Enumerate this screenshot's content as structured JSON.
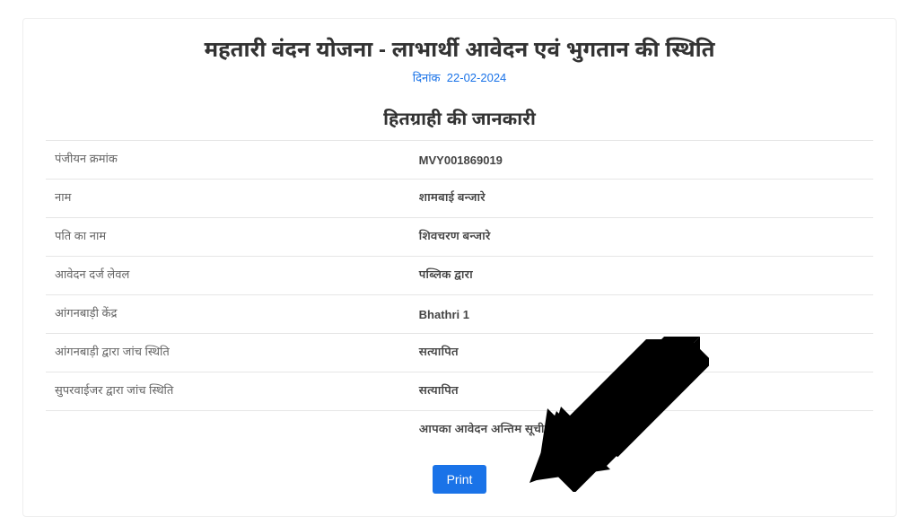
{
  "header": {
    "title": "महतारी वंदन योजना - लाभार्थी आवेदन एवं भुगतान की स्थिति",
    "date_prefix": "दिनांक",
    "date_value": "22-02-2024"
  },
  "section": {
    "heading": "हितग्राही की जानकारी"
  },
  "rows": {
    "r0": {
      "label": "पंजीयन क्रमांक",
      "value": "MVY001869019"
    },
    "r1": {
      "label": "नाम",
      "value": "शामबाई बन्जारे"
    },
    "r2": {
      "label": "पति का नाम",
      "value": "शिवचरण बन्जारे"
    },
    "r3": {
      "label": "आवेदन दर्ज लेवल",
      "value": "पब्लिक द्वारा"
    },
    "r4": {
      "label": "आंगनबाड़ी केंद्र",
      "value": "Bhathri 1"
    },
    "r5": {
      "label": "आंगनबाड़ी द्वारा जांच स्थिति",
      "value": "सत्यापित"
    },
    "r6": {
      "label": "सुपरवाईजर द्वारा जांच स्थिति",
      "value": "सत्यापित"
    },
    "r7": {
      "label": "",
      "value": "आपका आवेदन अन्तिम सूची में शामिल है"
    }
  },
  "actions": {
    "print_label": "Print"
  },
  "colors": {
    "accent": "#1a73e8",
    "success": "#28a745"
  }
}
